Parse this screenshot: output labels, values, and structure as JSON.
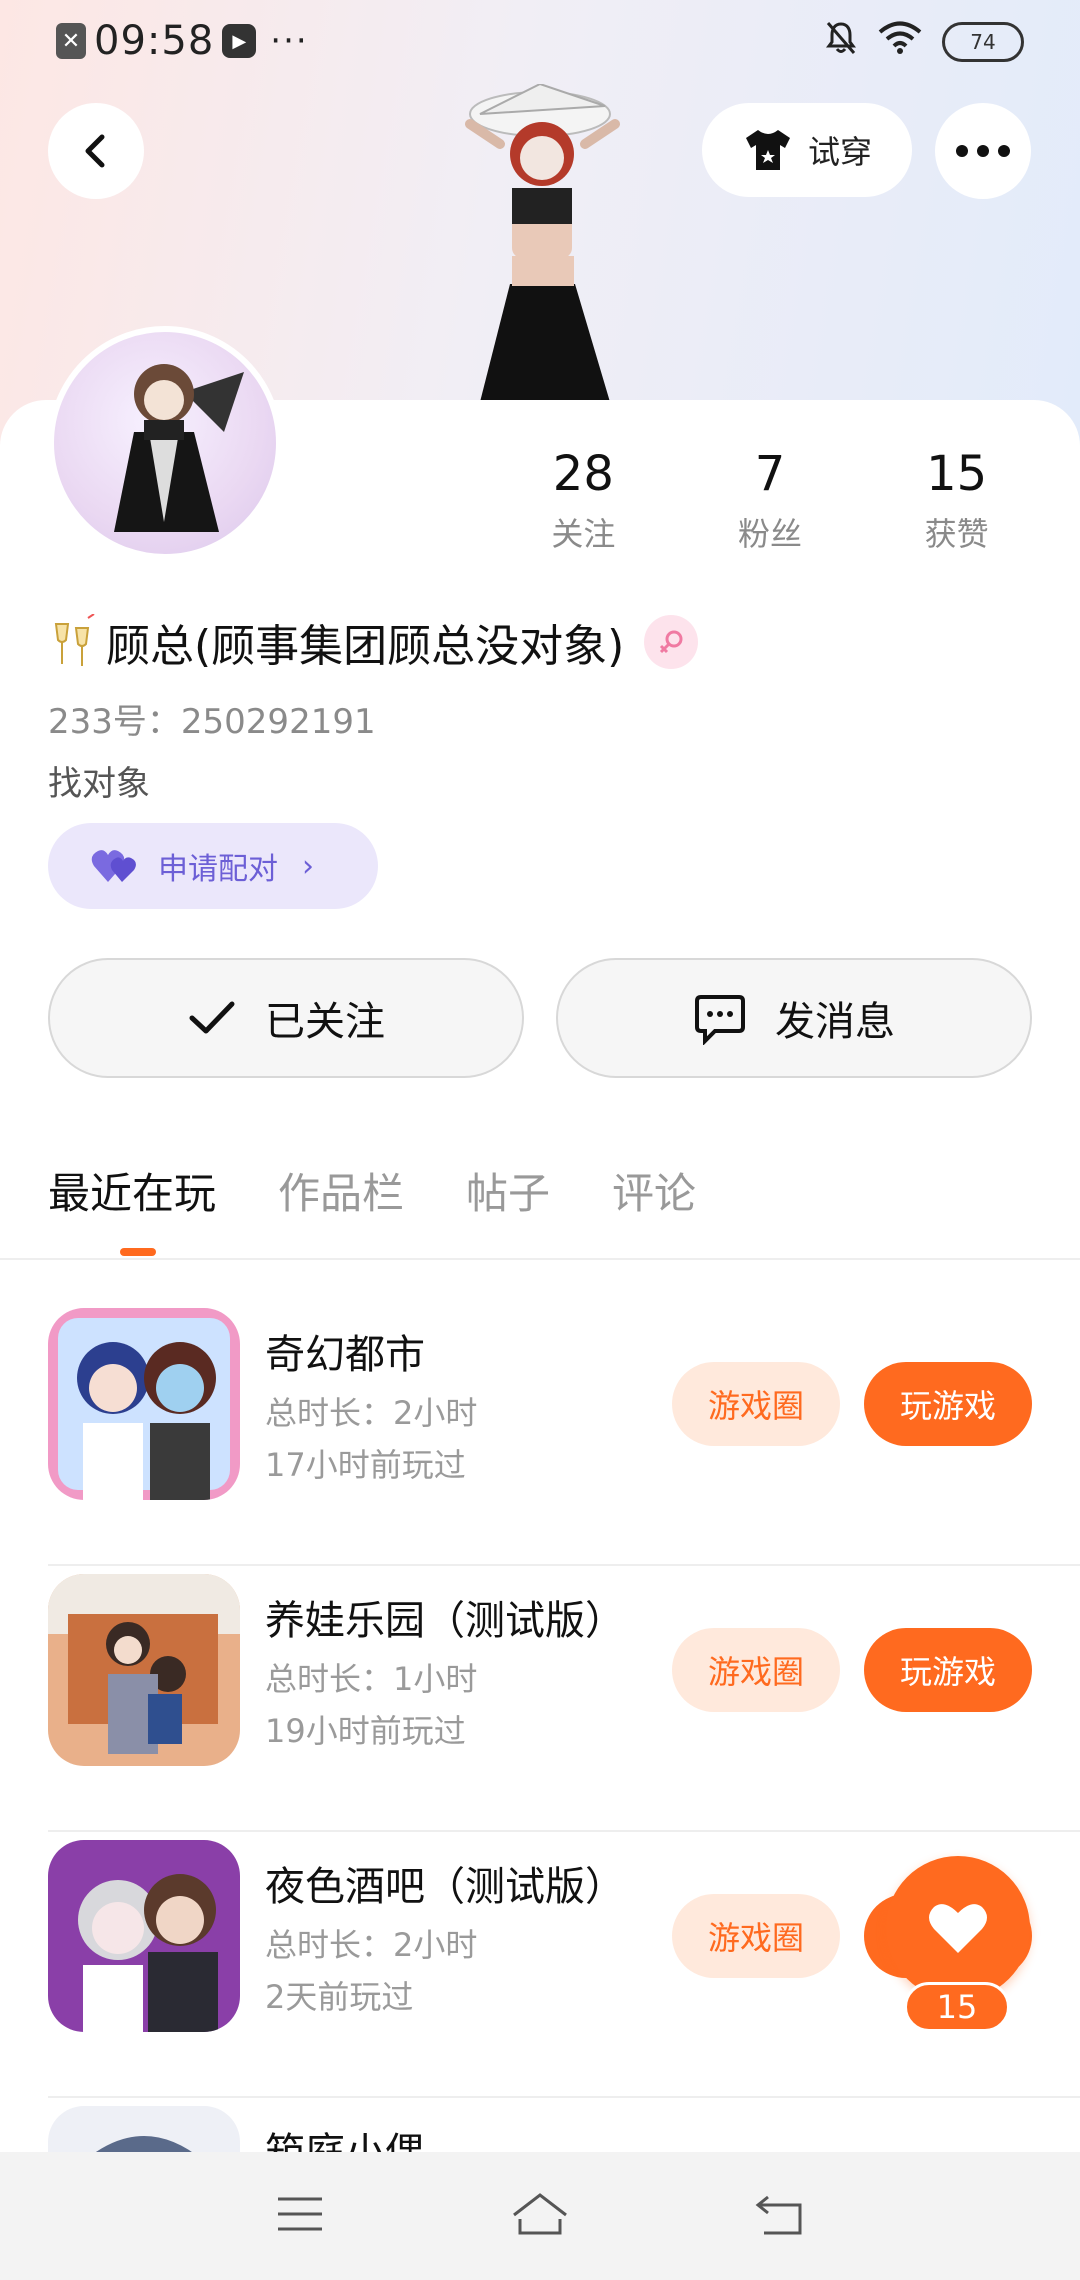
{
  "status_bar": {
    "time": "09:58",
    "dots": "···",
    "battery": "74",
    "icons": [
      "sim-off-icon",
      "screen-record-icon",
      "mute-bell-icon",
      "wifi-icon",
      "battery-icon"
    ]
  },
  "header": {
    "try_on_label": "试穿"
  },
  "profile": {
    "name": "顾总(顾事集团顾总没对象)",
    "id_label": "233号：",
    "id_value": "250292191",
    "bio": "找对象",
    "pair_label": "申请配对",
    "stats": [
      {
        "value": "28",
        "label": "关注"
      },
      {
        "value": "7",
        "label": "粉丝"
      },
      {
        "value": "15",
        "label": "获赞"
      }
    ]
  },
  "actions": {
    "follow_label": "已关注",
    "message_label": "发消息"
  },
  "tabs": [
    "最近在玩",
    "作品栏",
    "帖子",
    "评论"
  ],
  "games": [
    {
      "title": "奇幻都市",
      "duration": "总时长：2小时",
      "last_played": "17小时前玩过",
      "circle_label": "游戏圈",
      "play_label": "玩游戏"
    },
    {
      "title": "养娃乐园（测试版）",
      "duration": "总时长：1小时",
      "last_played": "19小时前玩过",
      "circle_label": "游戏圈",
      "play_label": "玩游戏"
    },
    {
      "title": "夜色酒吧（测试版）",
      "duration": "总时长：2小时",
      "last_played": "2天前玩过",
      "circle_label": "游戏圈",
      "play_label": "玩游戏"
    },
    {
      "title": "箱庭小偶",
      "duration": "",
      "last_played": "",
      "circle_label": "",
      "play_label": ""
    }
  ],
  "like_fab": {
    "count": "15"
  },
  "colors": {
    "accent": "#ff6a1f",
    "accent_light": "#ffe9dc",
    "pair_purple": "#6c5fd6",
    "pair_bg": "#ebe7fb"
  }
}
